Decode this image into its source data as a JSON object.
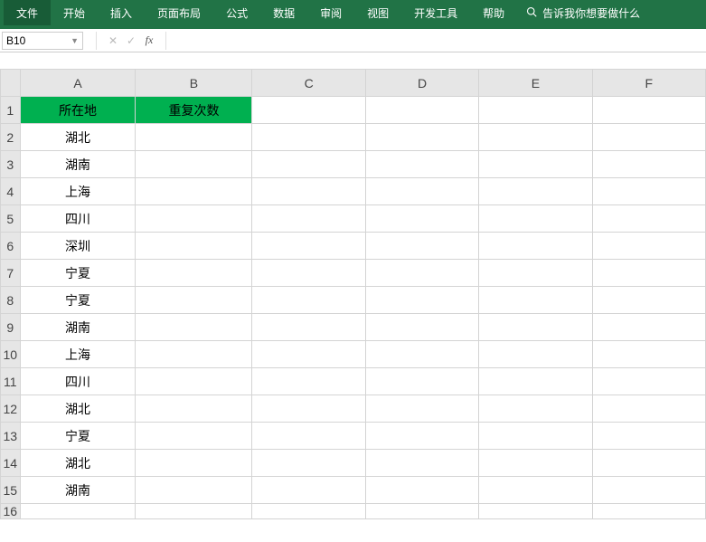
{
  "ribbon": {
    "tabs": [
      "文件",
      "开始",
      "插入",
      "页面布局",
      "公式",
      "数据",
      "审阅",
      "视图",
      "开发工具",
      "帮助"
    ],
    "search_placeholder": "告诉我你想要做什么"
  },
  "formula_bar": {
    "namebox": "B10",
    "cancel": "✕",
    "confirm": "✓",
    "fx": "fx",
    "formula": ""
  },
  "columns": [
    "A",
    "B",
    "C",
    "D",
    "E",
    "F"
  ],
  "header_row": {
    "A": "所在地",
    "B": "重复次数"
  },
  "data_rows": [
    "湖北",
    "湖南",
    "上海",
    "四川",
    "深圳",
    "宁夏",
    "宁夏",
    "湖南",
    "上海",
    "四川",
    "湖北",
    "宁夏",
    "湖北",
    "湖南"
  ],
  "selected_cell": "B10"
}
